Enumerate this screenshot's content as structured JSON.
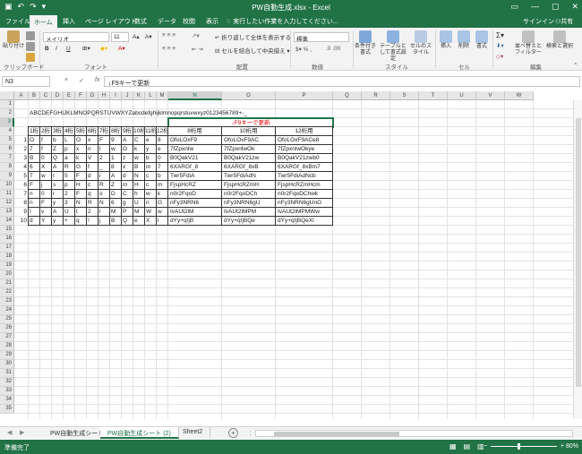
{
  "window": {
    "title": "PW自動生成.xlsx - Excel",
    "qat_icons": [
      "save-icon",
      "undo-icon",
      "redo-icon",
      "customize-icon"
    ]
  },
  "tabs": [
    {
      "label": "ファイル"
    },
    {
      "label": "ホーム"
    },
    {
      "label": "挿入"
    },
    {
      "label": "ページ レイアウト"
    },
    {
      "label": "数式"
    },
    {
      "label": "データ"
    },
    {
      "label": "校閲"
    },
    {
      "label": "表示"
    }
  ],
  "active_tab": "ホーム",
  "tellme": "実行したい作業を入力してください...",
  "signin": "サインイン",
  "share": "共有",
  "ribbon": {
    "clipboard": {
      "paste": "貼り付け",
      "label": "クリップボード"
    },
    "font": {
      "name": "メイリオ",
      "size": "11",
      "bold": "B",
      "italic": "I",
      "underline": "U",
      "label": "フォント"
    },
    "alignment": {
      "wrap": "折り返して全体を表示する",
      "merge": "セルを結合して中央揃え",
      "label": "配置"
    },
    "number": {
      "format": "標準",
      "label": "数値"
    },
    "styles": {
      "conditional": "条件付き書式",
      "table": "テーブルとして書式設定",
      "cell": "セルのスタイル",
      "label": "スタイル"
    },
    "cells": {
      "insert": "挿入",
      "delete": "削除",
      "format": "書式",
      "label": "セル"
    },
    "editing": {
      "sort": "並べ替えとフィルター",
      "find": "検索と選択",
      "label": "編集"
    }
  },
  "formula_bar": {
    "name_box": "N3",
    "cancel": "×",
    "enter": "✓",
    "fx": "fx",
    "formula": "↓F9キーで更新"
  },
  "columns": [
    "A",
    "B",
    "C",
    "D",
    "E",
    "F",
    "G",
    "H",
    "I",
    "J",
    "K",
    "L",
    "M",
    "N",
    "O",
    "P",
    "Q",
    "R",
    "S",
    "T",
    "U",
    "V",
    "W"
  ],
  "rows": [
    "1",
    "2",
    "3",
    "4",
    "5",
    "6",
    "7",
    "8",
    "9",
    "10",
    "11",
    "12",
    "13",
    "14",
    "15",
    "16",
    "17",
    "18",
    "19",
    "20",
    "21",
    "22",
    "23",
    "24",
    "25",
    "26",
    "27",
    "28",
    "29",
    "30",
    "31",
    "32",
    "33",
    "34",
    "35"
  ],
  "sheet": {
    "b2": "ABCDEFGHIJKLMNOPQRSTUVWXYZabcdefghijklmnopqrstuvwxyz0123456789+-_",
    "n3": "↓F9キーで更新",
    "headers": [
      "1桁",
      "2桁",
      "3桁",
      "4桁",
      "5桁",
      "6桁",
      "7桁",
      "8桁",
      "9桁",
      "10桁",
      "11桁",
      "12桁",
      "8桁用",
      "10桁用",
      "12桁用"
    ],
    "data_rows": [
      {
        "n": "1",
        "c": [
          "O",
          "f",
          "b",
          "L",
          "O",
          "x",
          "F",
          "9",
          "A",
          "C",
          "e",
          "8"
        ],
        "p8": "OfoLOxF9",
        "p10": "OfoLOxF9AC",
        "p12": "OfoLOxF9ACe8"
      },
      {
        "n": "2",
        "c": [
          "7",
          "f",
          "Z",
          "p",
          "x",
          "n",
          "l",
          "w",
          "O",
          "k",
          "y",
          "e"
        ],
        "p8": "7fZpxnlw",
        "p10": "7fZpxnlwOk",
        "p12": "7fZpxnlwOkye"
      },
      {
        "n": "3",
        "c": [
          "B",
          "0",
          "Q",
          "a",
          "k",
          "V",
          "2",
          "1",
          "z",
          "w",
          "b",
          "0"
        ],
        "p8": "B0QakV21",
        "p10": "B0QakV21zw",
        "p12": "B0QakV21zwb0"
      },
      {
        "n": "4",
        "c": [
          "6",
          "X",
          "A",
          "R",
          "G",
          "f",
          "_",
          "8",
          "x",
          "B",
          "m",
          "7"
        ],
        "p8": "6XARGf_8",
        "p10": "6XARGf_8xB",
        "p12": "6XARGf_8xBm7"
      },
      {
        "n": "5",
        "c": [
          "T",
          "w",
          "r",
          "5",
          "F",
          "d",
          "i",
          "A",
          "d",
          "N",
          "c",
          "b"
        ],
        "p8": "Twr5FdiA",
        "p10": "Twr5FdiAdN",
        "p12": "Twr5FdiAdNcb"
      },
      {
        "n": "6",
        "c": [
          "F",
          "j",
          "s",
          "p",
          "H",
          "c",
          "R",
          "Z",
          "m",
          "H",
          "c",
          "m"
        ],
        "p8": "FjspHcRZ",
        "p10": "FjspHcRZmH",
        "p12": "FjspHcRZmHcm"
      },
      {
        "n": "7",
        "c": [
          "n",
          "0",
          "r",
          "2",
          "F",
          "q",
          "o",
          "D",
          "C",
          "h",
          "w",
          "k"
        ],
        "p8": "n0r2FqoD",
        "p10": "n0r2FqoDCh",
        "p12": "n0r2FqoDChwk"
      },
      {
        "n": "8",
        "c": [
          "n",
          "F",
          "y",
          "3",
          "N",
          "R",
          "N",
          "6",
          "g",
          "U",
          "n",
          "G"
        ],
        "p8": "nFy3NRN6",
        "p10": "nFy3NRN6gU",
        "p12": "nFy3NRN6gUnG"
      },
      {
        "n": "9",
        "c": [
          "I",
          "v",
          "A",
          "U",
          "t",
          "2",
          "l",
          "M",
          "P",
          "M",
          "W",
          "w"
        ],
        "p8": "IvAUt2lM",
        "p10": "IvAUt2lMPM",
        "p12": "IvAUt2lMPMWw"
      },
      {
        "n": "10",
        "c": [
          "d",
          "Y",
          "y",
          "+",
          "q",
          "!",
          "j",
          "B",
          "Q",
          "e",
          "X",
          "l"
        ],
        "p8": "dYy+q!jB",
        "p10": "dYy+q!jBQe",
        "p12": "dYy+q!jBQeXl"
      }
    ]
  },
  "sheet_tabs": [
    {
      "label": "PW自動生成シート"
    },
    {
      "label": "PW自動生成シート (2)"
    },
    {
      "label": "Sheet2"
    }
  ],
  "status": {
    "ready": "準備完了",
    "zoom": "80%"
  },
  "colors": {
    "excel_green": "#217346",
    "highlight_red": "#e00000"
  }
}
